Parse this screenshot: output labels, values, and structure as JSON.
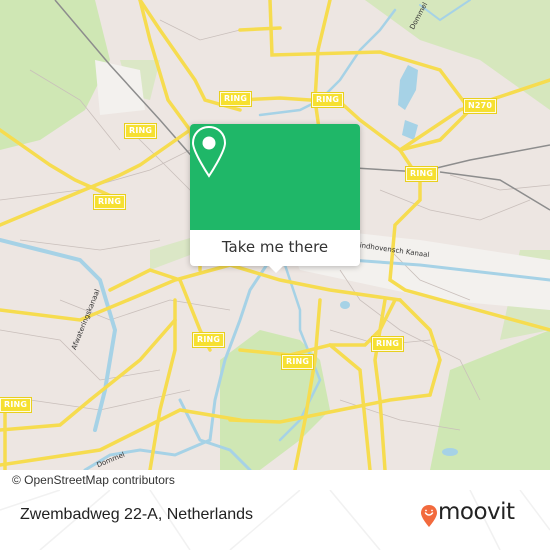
{
  "map": {
    "ring_labels": [
      "RING",
      "RING",
      "RING",
      "RING",
      "RING",
      "RING",
      "RING",
      "RING",
      "RING"
    ],
    "road_labels": {
      "n270": "N270"
    },
    "water_labels": {
      "dommel_north": "Dommel",
      "dommel_south": "Dommel",
      "kanaal": "Eindhovensch Kanaal",
      "afwateringskanaal": "Afwateringskanaal"
    },
    "attribution": "© OpenStreetMap contributors"
  },
  "popup": {
    "button_label": "Take me there",
    "accent_color": "#1fb768"
  },
  "footer": {
    "address": "Zwembadweg 22-A, Netherlands",
    "brand": "moovit",
    "brand_color": "#f26a3d"
  }
}
